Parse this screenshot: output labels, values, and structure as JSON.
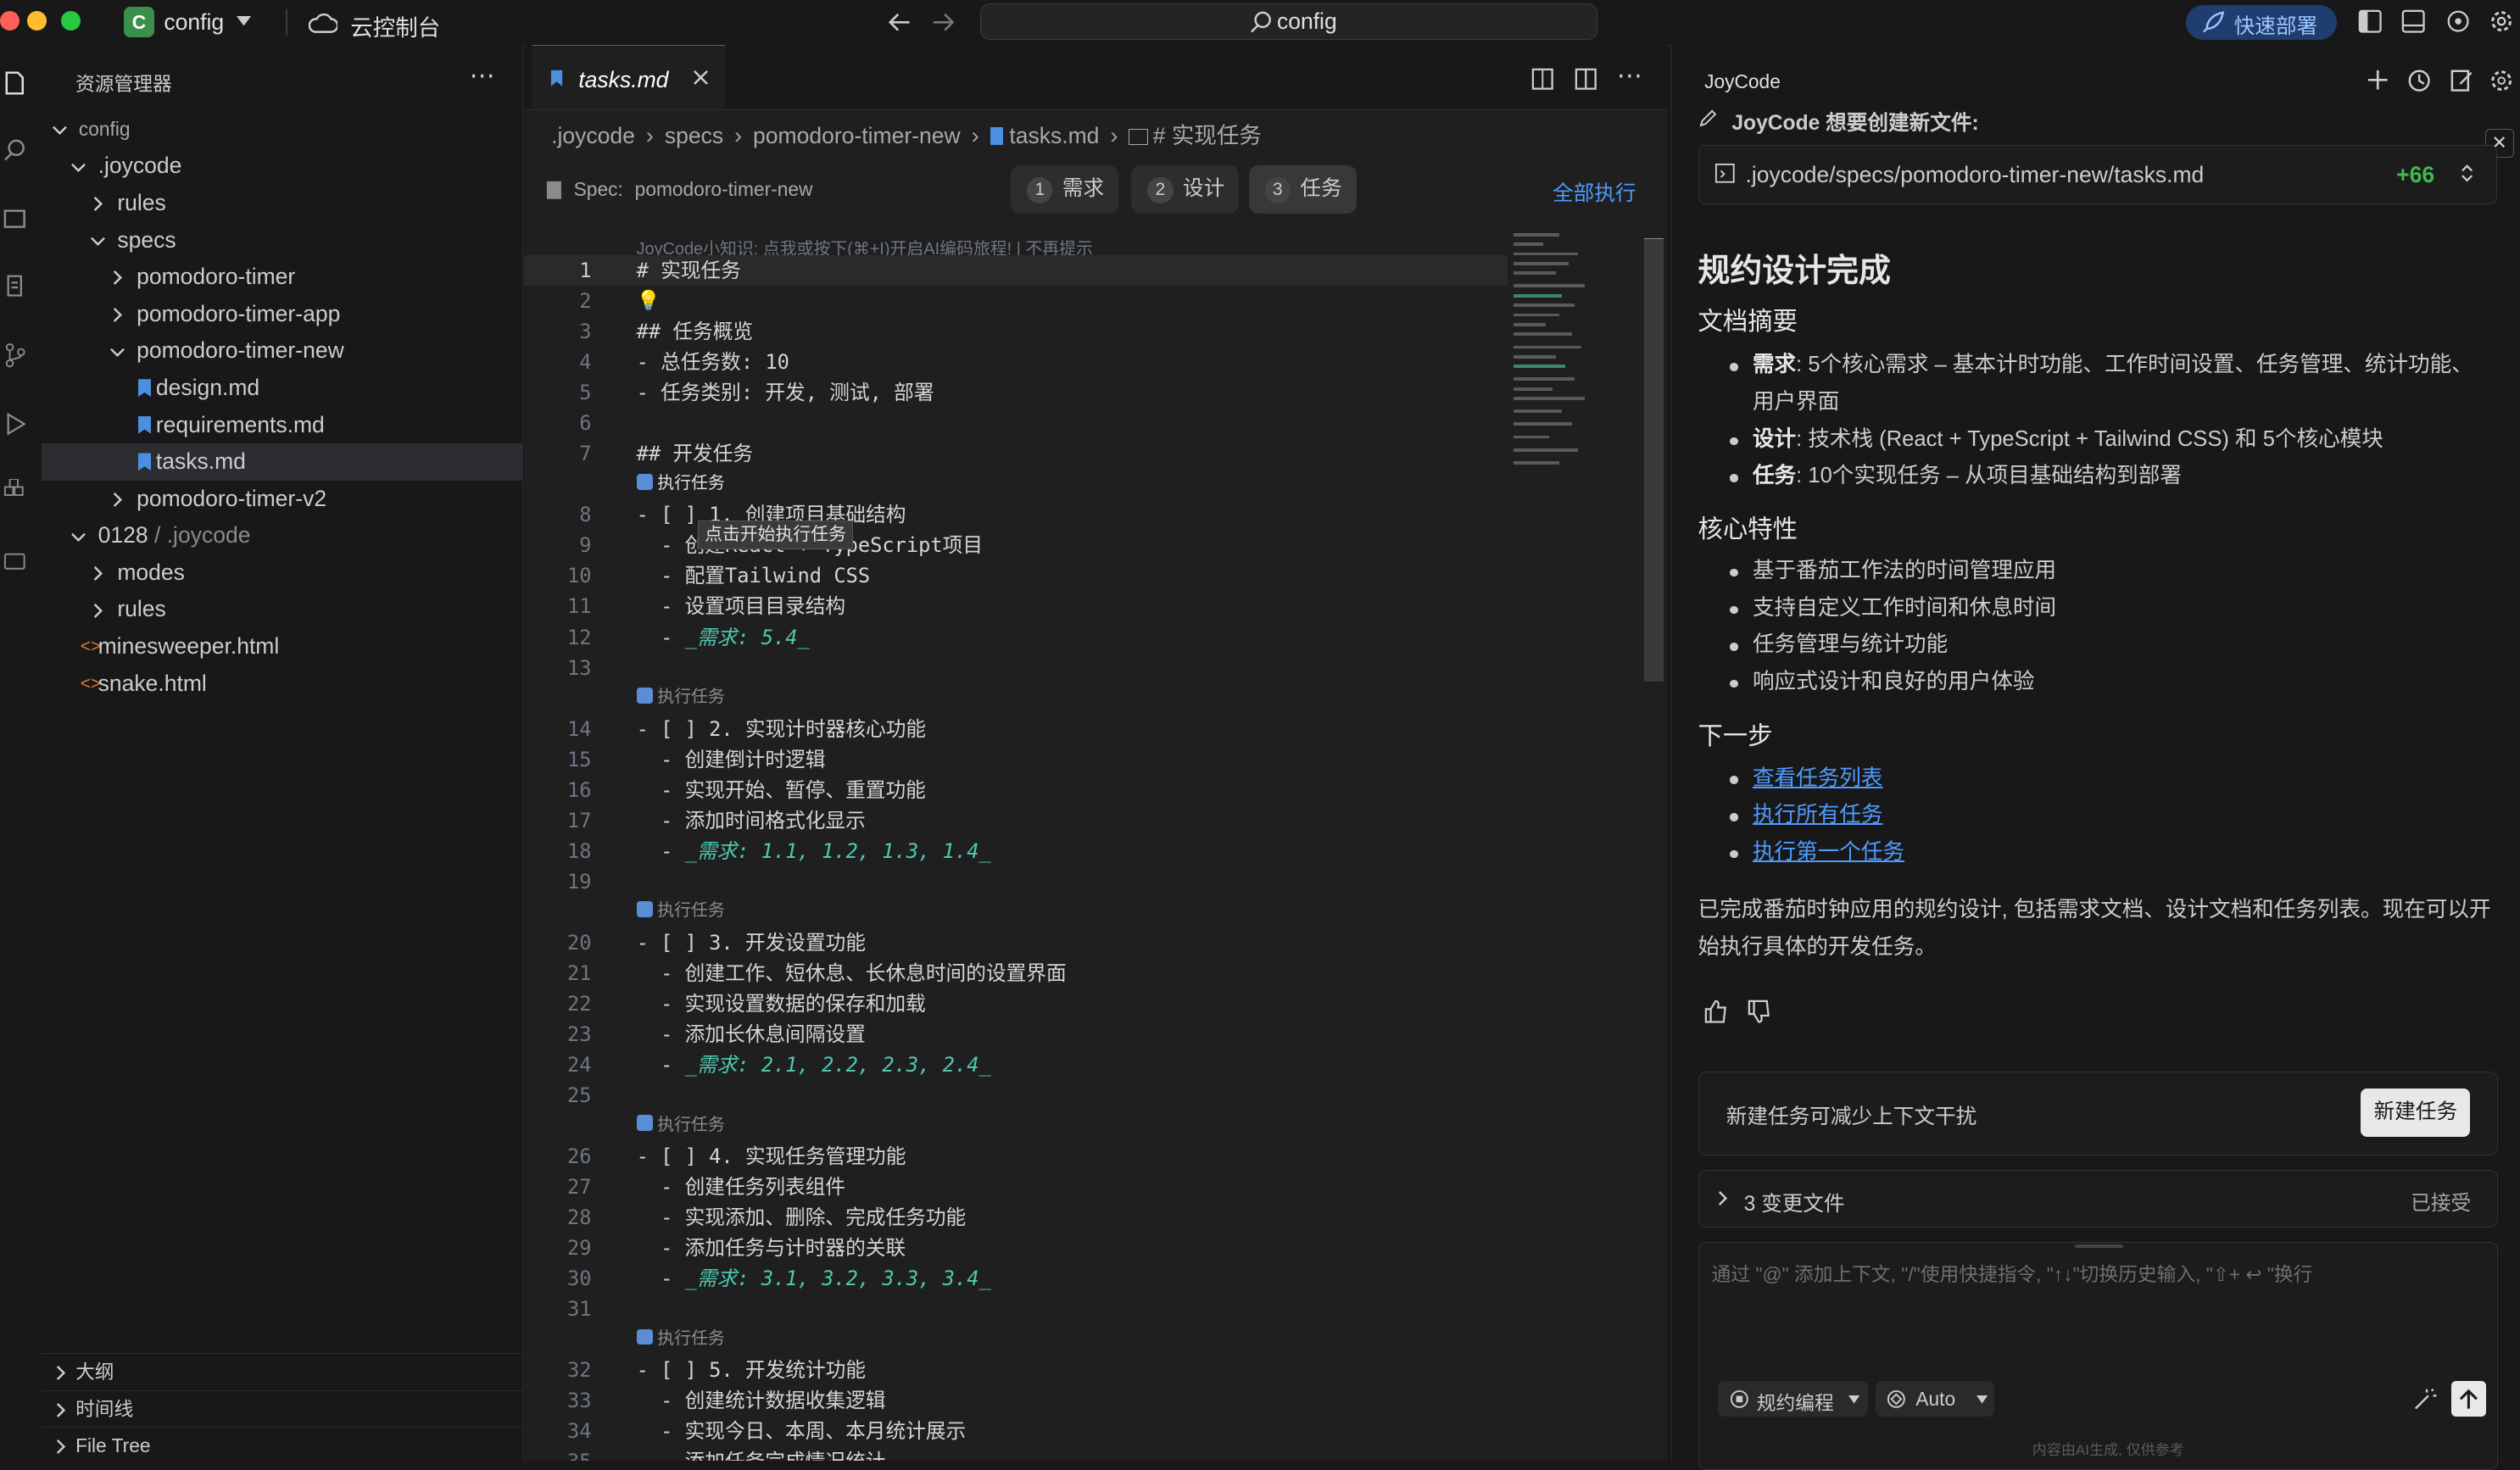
{
  "titlebar": {
    "project_letter": "C",
    "project_name": "config",
    "cloud_label": "云控制台",
    "command_center": "config",
    "deploy_label": "快速部署"
  },
  "sidebar": {
    "title": "资源管理器",
    "tree": [
      {
        "label": "config",
        "depth": 0
      },
      {
        "label": ".joycode",
        "depth": 1
      },
      {
        "label": "rules",
        "depth": 2
      },
      {
        "label": "specs",
        "depth": 2
      },
      {
        "label": "pomodoro-timer",
        "depth": 3
      },
      {
        "label": "pomodoro-timer-app",
        "depth": 3
      },
      {
        "label": "pomodoro-timer-new",
        "depth": 3
      },
      {
        "label": "design.md",
        "depth": 4
      },
      {
        "label": "requirements.md",
        "depth": 4
      },
      {
        "label": "tasks.md",
        "depth": 4
      },
      {
        "label": "pomodoro-timer-v2",
        "depth": 3
      },
      {
        "label": "0128",
        "depth": 1,
        "suffix": " / .joycode"
      },
      {
        "label": "modes",
        "depth": 2
      },
      {
        "label": "rules",
        "depth": 2
      },
      {
        "label": "minesweeper.html",
        "depth": 1
      },
      {
        "label": "snake.html",
        "depth": 1
      }
    ],
    "sections": [
      "大纲",
      "时间线",
      "File Tree"
    ]
  },
  "editor": {
    "tab_label": "tasks.md",
    "breadcrumb": [
      ".joycode",
      "specs",
      "pomodoro-timer-new",
      "tasks.md",
      "# 实现任务"
    ],
    "spec_label": "Spec:",
    "spec_name": "pomodoro-timer-new",
    "steps": [
      {
        "num": "1",
        "label": "需求"
      },
      {
        "num": "2",
        "label": "设计"
      },
      {
        "num": "3",
        "label": "任务"
      }
    ],
    "run_all": "全部执行",
    "hint": "JoyCode小知识: 点我或按下(⌘+I)开启AI编码旅程! | 不再提示",
    "tooltip": "点击开始执行任务",
    "codelens_first": "执行任务",
    "codelens": "执行任务",
    "lines": [
      "# 实现任务",
      "",
      "## 任务概览",
      "- 总任务数: 10",
      "- 任务类别: 开发, 测试, 部署",
      "",
      "## 开发任务",
      "- [ ] 1. 创建项目基础结构",
      "  - 创建React + TypeScript项目",
      "  - 配置Tailwind CSS",
      "  - 设置项目目录结构",
      "  - _需求: 5.4_",
      "",
      "- [ ] 2. 实现计时器核心功能",
      "  - 创建倒计时逻辑",
      "  - 实现开始、暂停、重置功能",
      "  - 添加时间格式化显示",
      "  - _需求: 1.1, 1.2, 1.3, 1.4_",
      "",
      "- [ ] 3. 开发设置功能",
      "  - 创建工作、短休息、长休息时间的设置界面",
      "  - 实现设置数据的保存和加载",
      "  - 添加长休息间隔设置",
      "  - _需求: 2.1, 2.2, 2.3, 2.4_",
      "",
      "- [ ] 4. 实现任务管理功能",
      "  - 创建任务列表组件",
      "  - 实现添加、删除、完成任务功能",
      "  - 添加任务与计时器的关联",
      "  - _需求: 3.1, 3.2, 3.3, 3.4_",
      "",
      "- [ ] 5. 开发统计功能",
      "  - 创建统计数据收集逻辑",
      "  - 实现今日、本周、本月统计展示",
      "  - 添加任务完成情况统计"
    ]
  },
  "chat": {
    "title": "JoyCode",
    "create_notice": "JoyCode 想要创建新文件:",
    "file_path": ".joycode/specs/pomodoro-timer-new/tasks.md",
    "diff_count": "+66",
    "heading": "规约设计完成",
    "summary_title": "文档摘要",
    "summary": [
      {
        "key": "需求",
        "text": ": 5个核心需求 – 基本计时功能、工作时间设置、任务管理、统计功能、用户界面"
      },
      {
        "key": "设计",
        "text": ": 技术栈 (React + TypeScript + Tailwind CSS) 和 5个核心模块"
      },
      {
        "key": "任务",
        "text": ": 10个实现任务 – 从项目基础结构到部署"
      }
    ],
    "features_title": "核心特性",
    "features": [
      "基于番茄工作法的时间管理应用",
      "支持自定义工作时间和休息时间",
      "任务管理与统计功能",
      "响应式设计和良好的用户体验"
    ],
    "next_title": "下一步",
    "next_links": [
      "查看任务列表",
      "执行所有任务",
      "执行第一个任务"
    ],
    "conclusion": "已完成番茄时钟应用的规约设计, 包括需求文档、设计文档和任务列表。现在可以开始执行具体的开发任务。",
    "new_task_hint": "新建任务可减少上下文干扰",
    "new_task_button": "新建任务",
    "changed_files": "3 变更文件",
    "accepted": "已接受",
    "input_placeholder": "通过 \"@\" 添加上下文, \"/\"使用快捷指令, \"↑↓\"切换历史输入, \"⇧+ ↩ \"换行",
    "mode_label": "规约编程",
    "model_label": "Auto",
    "disclaimer": "内容由AI生成, 仅供参考"
  },
  "colors": {
    "accent": "#0078d4",
    "link": "#4f9bff",
    "diff_add": "#3fb950",
    "requirement": "#4ec9b0"
  }
}
